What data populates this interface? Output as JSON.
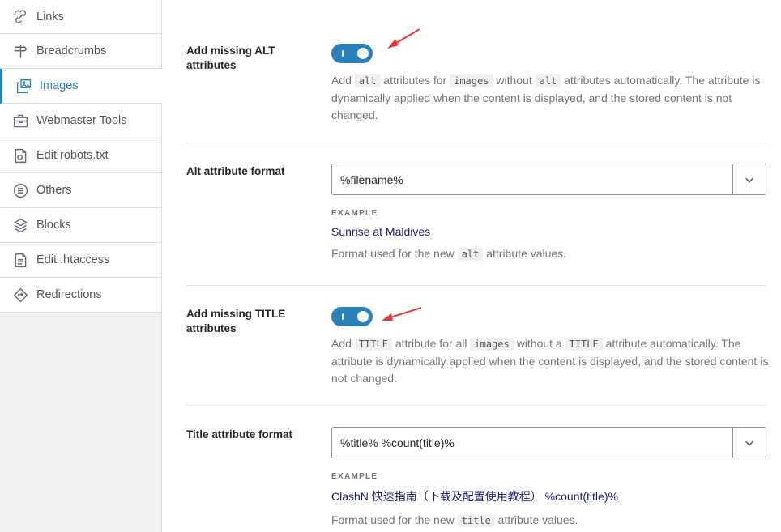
{
  "sidebar": {
    "items": [
      {
        "label": "Links",
        "icon": "links-icon"
      },
      {
        "label": "Breadcrumbs",
        "icon": "signpost-icon"
      },
      {
        "label": "Images",
        "icon": "images-icon",
        "active": true
      },
      {
        "label": "Webmaster Tools",
        "icon": "toolbox-icon"
      },
      {
        "label": "Edit robots.txt",
        "icon": "robot-file-icon"
      },
      {
        "label": "Others",
        "icon": "list-circle-icon"
      },
      {
        "label": "Blocks",
        "icon": "blocks-icon"
      },
      {
        "label": "Edit .htaccess",
        "icon": "file-text-icon"
      },
      {
        "label": "Redirections",
        "icon": "redirect-icon"
      }
    ]
  },
  "settings": {
    "alt_missing": {
      "label": "Add missing ALT attributes",
      "enabled": true,
      "desc_add": "Add",
      "code_alt": "alt",
      "desc_for": "attributes for",
      "code_images": "images",
      "desc_without": "without",
      "code_alt2": "alt",
      "desc_rest": "attributes automatically. The attribute is dynamically applied when the content is displayed, and the stored content is not changed."
    },
    "alt_format": {
      "label": "Alt attribute format",
      "value": "%filename%",
      "example_label": "EXAMPLE",
      "example_value": "Sunrise at Maldives",
      "help_prefix": "Format used for the new",
      "help_code": "alt",
      "help_suffix": "attribute values."
    },
    "title_missing": {
      "label": "Add missing TITLE attributes",
      "enabled": true,
      "desc_add": "Add",
      "code_title": "TITLE",
      "desc_for": "attribute for all",
      "code_images": "images",
      "desc_without": "without a",
      "code_title2": "TITLE",
      "desc_rest": "attribute automatically. The attribute is dynamically applied when the content is displayed, and the stored content is not changed."
    },
    "title_format": {
      "label": "Title attribute format",
      "value": "%title% %count(title)%",
      "example_label": "EXAMPLE",
      "example_value": "ClashN 快速指南（下载及配置使用教程） %count(title)%",
      "help_prefix": "Format used for the new",
      "help_code": "title",
      "help_suffix": "attribute values."
    }
  },
  "colors": {
    "accent": "#2a80b9",
    "arrow": "#e53935"
  }
}
